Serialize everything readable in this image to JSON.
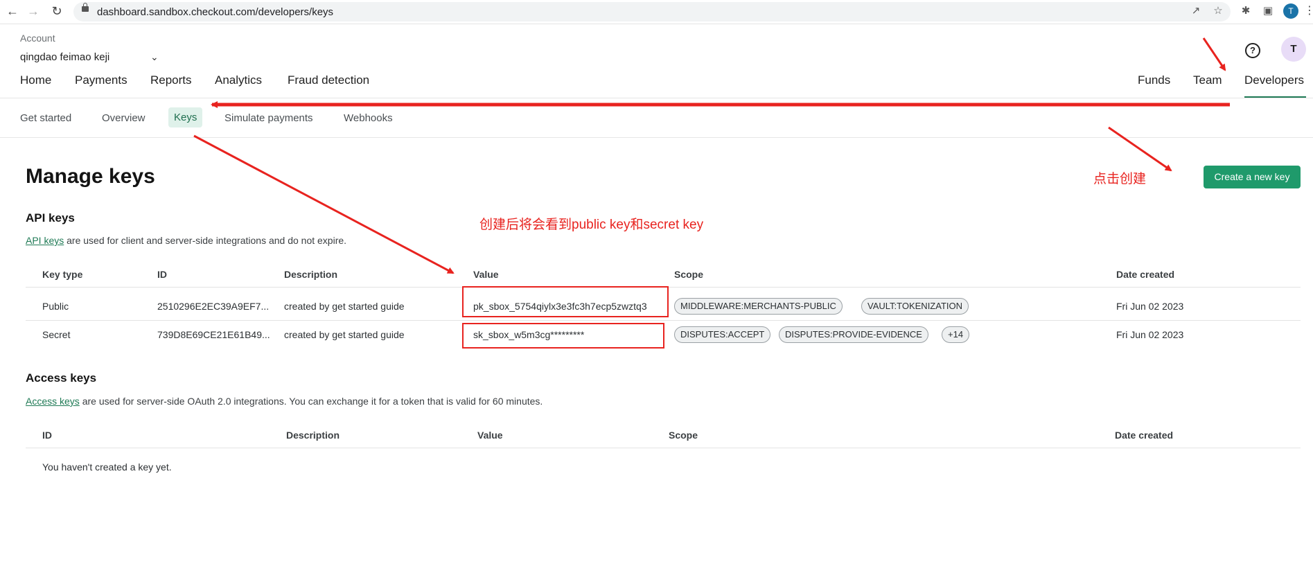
{
  "browser": {
    "url": "dashboard.sandbox.checkout.com/developers/keys",
    "profile_initial": "T"
  },
  "header": {
    "account_label": "Account",
    "account_name": "qingdao feimao keji",
    "nav_left": [
      "Home",
      "Payments",
      "Reports",
      "Analytics",
      "Fraud detection"
    ],
    "nav_right": [
      "Funds",
      "Team",
      "Developers"
    ],
    "help_glyph": "?",
    "avatar_initial": "T"
  },
  "subnav": {
    "items": [
      "Get started",
      "Overview",
      "Keys",
      "Simulate payments",
      "Webhooks"
    ],
    "active": "Keys"
  },
  "page": {
    "title": "Manage keys",
    "create_button": "Create a new key"
  },
  "api_keys": {
    "title": "API keys",
    "link": "API keys",
    "desc_rest": " are used for client and server-side integrations and do not expire.",
    "columns": [
      "Key type",
      "ID",
      "Description",
      "Value",
      "Scope",
      "Date created"
    ],
    "rows": [
      {
        "type": "Public",
        "id": "2510296E2EC39A9EF7...",
        "description": "created by get started guide",
        "value": "pk_sbox_5754qiylx3e3fc3h7ecp5zwztq3",
        "scopes": [
          "MIDDLEWARE:MERCHANTS-PUBLIC",
          "VAULT:TOKENIZATION"
        ],
        "date": "Fri Jun 02 2023"
      },
      {
        "type": "Secret",
        "id": "739D8E69CE21E61B49...",
        "description": "created by get started guide",
        "value": "sk_sbox_w5m3cg*********",
        "scopes": [
          "DISPUTES:ACCEPT",
          "DISPUTES:PROVIDE-EVIDENCE",
          "+14"
        ],
        "date": "Fri Jun 02 2023"
      }
    ]
  },
  "access_keys": {
    "title": "Access keys",
    "link": "Access keys",
    "desc_rest": " are used for server-side OAuth 2.0 integrations. You can exchange it for a token that is valid for 60 minutes.",
    "columns": [
      "ID",
      "Description",
      "Value",
      "Scope",
      "Date created"
    ],
    "empty": "You haven't created a key yet."
  },
  "annotations": {
    "click_create": "点击创建",
    "after_create": "创建后将会看到public key和secret key",
    "color": "#e8231f"
  }
}
